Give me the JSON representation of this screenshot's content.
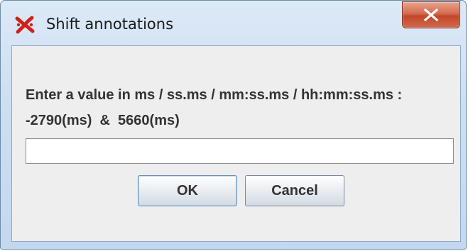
{
  "window": {
    "title": "Shift annotations",
    "app_icon": "red-x-logo-icon",
    "close_icon": "close-icon",
    "colors": {
      "titlebar": "#cddff2",
      "close_button": "#c14629",
      "content_bg": "#eeeeee"
    }
  },
  "dialog": {
    "message_line1": "Enter a value in ms / ss.ms / mm:ss.ms / hh:mm:ss.ms :",
    "message_line2": "-2790(ms)  &  5660(ms)",
    "input_value": "",
    "ok_label": "OK",
    "cancel_label": "Cancel"
  }
}
